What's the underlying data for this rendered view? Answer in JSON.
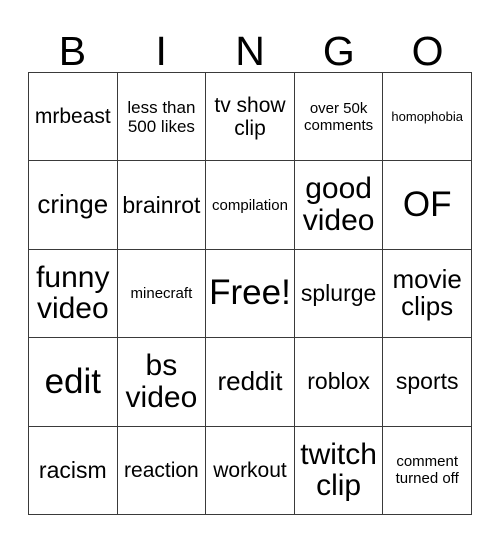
{
  "card": {
    "type": "bingo-card",
    "columns": 5,
    "rows": 5,
    "header_letters": [
      "B",
      "I",
      "N",
      "G",
      "O"
    ],
    "border_color": "#3a3a3a",
    "background_color": "#ffffff",
    "text_color": "#000000",
    "free_space": "Free!",
    "free_space_position": {
      "row": 3,
      "column": 3
    }
  },
  "cells": [
    [
      {
        "text": "mrbeast",
        "size": "m"
      },
      {
        "text": "less than 500 likes",
        "size": "sm"
      },
      {
        "text": "tv show clip",
        "size": "m"
      },
      {
        "text": "over 50k comments",
        "size": "s"
      },
      {
        "text": "homophobia",
        "size": "xs"
      }
    ],
    [
      {
        "text": "cringe",
        "size": "l"
      },
      {
        "text": "brainrot",
        "size": "ml"
      },
      {
        "text": "compilation",
        "size": "s"
      },
      {
        "text": "good video",
        "size": "xl"
      },
      {
        "text": "OF",
        "size": "xxl"
      }
    ],
    [
      {
        "text": "funny video",
        "size": "xl"
      },
      {
        "text": "minecraft",
        "size": "s"
      },
      {
        "text": "Free!",
        "size": "xxl"
      },
      {
        "text": "splurge",
        "size": "ml"
      },
      {
        "text": "movie clips",
        "size": "l"
      }
    ],
    [
      {
        "text": "edit",
        "size": "xxl"
      },
      {
        "text": "bs video",
        "size": "xl"
      },
      {
        "text": "reddit",
        "size": "l"
      },
      {
        "text": "roblox",
        "size": "ml"
      },
      {
        "text": "sports",
        "size": "ml"
      }
    ],
    [
      {
        "text": "racism",
        "size": "ml"
      },
      {
        "text": "reaction",
        "size": "m"
      },
      {
        "text": "workout",
        "size": "m"
      },
      {
        "text": "twitch clip",
        "size": "xl"
      },
      {
        "text": "comment turned off",
        "size": "s"
      }
    ]
  ]
}
